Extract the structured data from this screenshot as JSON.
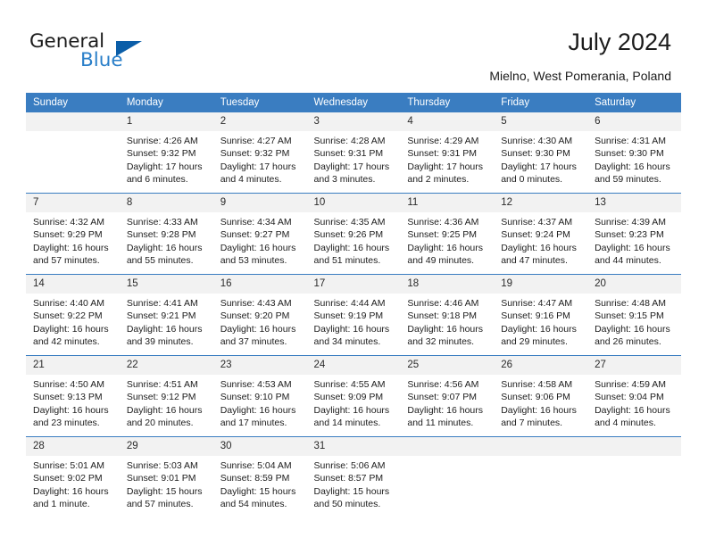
{
  "brand": {
    "name_part1": "General",
    "name_part2": "Blue",
    "accent_color": "#2a7fc9",
    "triangle_color": "#0b5ea8"
  },
  "header": {
    "title": "July 2024",
    "location": "Mielno, West Pomerania, Poland"
  },
  "calendar": {
    "header_bg": "#3a7dc1",
    "daynum_bg": "#f2f2f2",
    "weekday_labels": [
      "Sunday",
      "Monday",
      "Tuesday",
      "Wednesday",
      "Thursday",
      "Friday",
      "Saturday"
    ],
    "weeks": [
      [
        {
          "day": "",
          "sunrise": "",
          "sunset": "",
          "daylight_line1": "",
          "daylight_line2": ""
        },
        {
          "day": "1",
          "sunrise": "Sunrise: 4:26 AM",
          "sunset": "Sunset: 9:32 PM",
          "daylight_line1": "Daylight: 17 hours",
          "daylight_line2": "and 6 minutes."
        },
        {
          "day": "2",
          "sunrise": "Sunrise: 4:27 AM",
          "sunset": "Sunset: 9:32 PM",
          "daylight_line1": "Daylight: 17 hours",
          "daylight_line2": "and 4 minutes."
        },
        {
          "day": "3",
          "sunrise": "Sunrise: 4:28 AM",
          "sunset": "Sunset: 9:31 PM",
          "daylight_line1": "Daylight: 17 hours",
          "daylight_line2": "and 3 minutes."
        },
        {
          "day": "4",
          "sunrise": "Sunrise: 4:29 AM",
          "sunset": "Sunset: 9:31 PM",
          "daylight_line1": "Daylight: 17 hours",
          "daylight_line2": "and 2 minutes."
        },
        {
          "day": "5",
          "sunrise": "Sunrise: 4:30 AM",
          "sunset": "Sunset: 9:30 PM",
          "daylight_line1": "Daylight: 17 hours",
          "daylight_line2": "and 0 minutes."
        },
        {
          "day": "6",
          "sunrise": "Sunrise: 4:31 AM",
          "sunset": "Sunset: 9:30 PM",
          "daylight_line1": "Daylight: 16 hours",
          "daylight_line2": "and 59 minutes."
        }
      ],
      [
        {
          "day": "7",
          "sunrise": "Sunrise: 4:32 AM",
          "sunset": "Sunset: 9:29 PM",
          "daylight_line1": "Daylight: 16 hours",
          "daylight_line2": "and 57 minutes."
        },
        {
          "day": "8",
          "sunrise": "Sunrise: 4:33 AM",
          "sunset": "Sunset: 9:28 PM",
          "daylight_line1": "Daylight: 16 hours",
          "daylight_line2": "and 55 minutes."
        },
        {
          "day": "9",
          "sunrise": "Sunrise: 4:34 AM",
          "sunset": "Sunset: 9:27 PM",
          "daylight_line1": "Daylight: 16 hours",
          "daylight_line2": "and 53 minutes."
        },
        {
          "day": "10",
          "sunrise": "Sunrise: 4:35 AM",
          "sunset": "Sunset: 9:26 PM",
          "daylight_line1": "Daylight: 16 hours",
          "daylight_line2": "and 51 minutes."
        },
        {
          "day": "11",
          "sunrise": "Sunrise: 4:36 AM",
          "sunset": "Sunset: 9:25 PM",
          "daylight_line1": "Daylight: 16 hours",
          "daylight_line2": "and 49 minutes."
        },
        {
          "day": "12",
          "sunrise": "Sunrise: 4:37 AM",
          "sunset": "Sunset: 9:24 PM",
          "daylight_line1": "Daylight: 16 hours",
          "daylight_line2": "and 47 minutes."
        },
        {
          "day": "13",
          "sunrise": "Sunrise: 4:39 AM",
          "sunset": "Sunset: 9:23 PM",
          "daylight_line1": "Daylight: 16 hours",
          "daylight_line2": "and 44 minutes."
        }
      ],
      [
        {
          "day": "14",
          "sunrise": "Sunrise: 4:40 AM",
          "sunset": "Sunset: 9:22 PM",
          "daylight_line1": "Daylight: 16 hours",
          "daylight_line2": "and 42 minutes."
        },
        {
          "day": "15",
          "sunrise": "Sunrise: 4:41 AM",
          "sunset": "Sunset: 9:21 PM",
          "daylight_line1": "Daylight: 16 hours",
          "daylight_line2": "and 39 minutes."
        },
        {
          "day": "16",
          "sunrise": "Sunrise: 4:43 AM",
          "sunset": "Sunset: 9:20 PM",
          "daylight_line1": "Daylight: 16 hours",
          "daylight_line2": "and 37 minutes."
        },
        {
          "day": "17",
          "sunrise": "Sunrise: 4:44 AM",
          "sunset": "Sunset: 9:19 PM",
          "daylight_line1": "Daylight: 16 hours",
          "daylight_line2": "and 34 minutes."
        },
        {
          "day": "18",
          "sunrise": "Sunrise: 4:46 AM",
          "sunset": "Sunset: 9:18 PM",
          "daylight_line1": "Daylight: 16 hours",
          "daylight_line2": "and 32 minutes."
        },
        {
          "day": "19",
          "sunrise": "Sunrise: 4:47 AM",
          "sunset": "Sunset: 9:16 PM",
          "daylight_line1": "Daylight: 16 hours",
          "daylight_line2": "and 29 minutes."
        },
        {
          "day": "20",
          "sunrise": "Sunrise: 4:48 AM",
          "sunset": "Sunset: 9:15 PM",
          "daylight_line1": "Daylight: 16 hours",
          "daylight_line2": "and 26 minutes."
        }
      ],
      [
        {
          "day": "21",
          "sunrise": "Sunrise: 4:50 AM",
          "sunset": "Sunset: 9:13 PM",
          "daylight_line1": "Daylight: 16 hours",
          "daylight_line2": "and 23 minutes."
        },
        {
          "day": "22",
          "sunrise": "Sunrise: 4:51 AM",
          "sunset": "Sunset: 9:12 PM",
          "daylight_line1": "Daylight: 16 hours",
          "daylight_line2": "and 20 minutes."
        },
        {
          "day": "23",
          "sunrise": "Sunrise: 4:53 AM",
          "sunset": "Sunset: 9:10 PM",
          "daylight_line1": "Daylight: 16 hours",
          "daylight_line2": "and 17 minutes."
        },
        {
          "day": "24",
          "sunrise": "Sunrise: 4:55 AM",
          "sunset": "Sunset: 9:09 PM",
          "daylight_line1": "Daylight: 16 hours",
          "daylight_line2": "and 14 minutes."
        },
        {
          "day": "25",
          "sunrise": "Sunrise: 4:56 AM",
          "sunset": "Sunset: 9:07 PM",
          "daylight_line1": "Daylight: 16 hours",
          "daylight_line2": "and 11 minutes."
        },
        {
          "day": "26",
          "sunrise": "Sunrise: 4:58 AM",
          "sunset": "Sunset: 9:06 PM",
          "daylight_line1": "Daylight: 16 hours",
          "daylight_line2": "and 7 minutes."
        },
        {
          "day": "27",
          "sunrise": "Sunrise: 4:59 AM",
          "sunset": "Sunset: 9:04 PM",
          "daylight_line1": "Daylight: 16 hours",
          "daylight_line2": "and 4 minutes."
        }
      ],
      [
        {
          "day": "28",
          "sunrise": "Sunrise: 5:01 AM",
          "sunset": "Sunset: 9:02 PM",
          "daylight_line1": "Daylight: 16 hours",
          "daylight_line2": "and 1 minute."
        },
        {
          "day": "29",
          "sunrise": "Sunrise: 5:03 AM",
          "sunset": "Sunset: 9:01 PM",
          "daylight_line1": "Daylight: 15 hours",
          "daylight_line2": "and 57 minutes."
        },
        {
          "day": "30",
          "sunrise": "Sunrise: 5:04 AM",
          "sunset": "Sunset: 8:59 PM",
          "daylight_line1": "Daylight: 15 hours",
          "daylight_line2": "and 54 minutes."
        },
        {
          "day": "31",
          "sunrise": "Sunrise: 5:06 AM",
          "sunset": "Sunset: 8:57 PM",
          "daylight_line1": "Daylight: 15 hours",
          "daylight_line2": "and 50 minutes."
        },
        {
          "day": "",
          "sunrise": "",
          "sunset": "",
          "daylight_line1": "",
          "daylight_line2": ""
        },
        {
          "day": "",
          "sunrise": "",
          "sunset": "",
          "daylight_line1": "",
          "daylight_line2": ""
        },
        {
          "day": "",
          "sunrise": "",
          "sunset": "",
          "daylight_line1": "",
          "daylight_line2": ""
        }
      ]
    ]
  }
}
